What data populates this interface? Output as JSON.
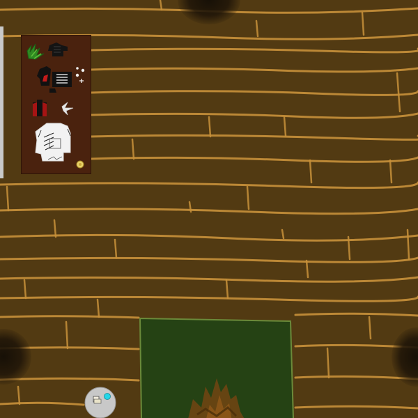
{
  "scene": {
    "floor_color": "#523a12",
    "plank_line_color": "#c8913a",
    "wall_color": "#c9c9c9",
    "shelf_color": "#4a220e",
    "rug_color": "#264214",
    "fire_color": "#7a4a14"
  },
  "objects": {
    "shelf_items": [
      "green-plant-icon",
      "black-leather-armor-icon",
      "black-red-shirt-icon",
      "small-items-icon",
      "red-black-backpack-icon",
      "grappling-hook-icon",
      "white-robe-icon",
      "gold-coin-icon"
    ],
    "player": "player-character-icon",
    "rug": "campfire-rug-icon"
  }
}
